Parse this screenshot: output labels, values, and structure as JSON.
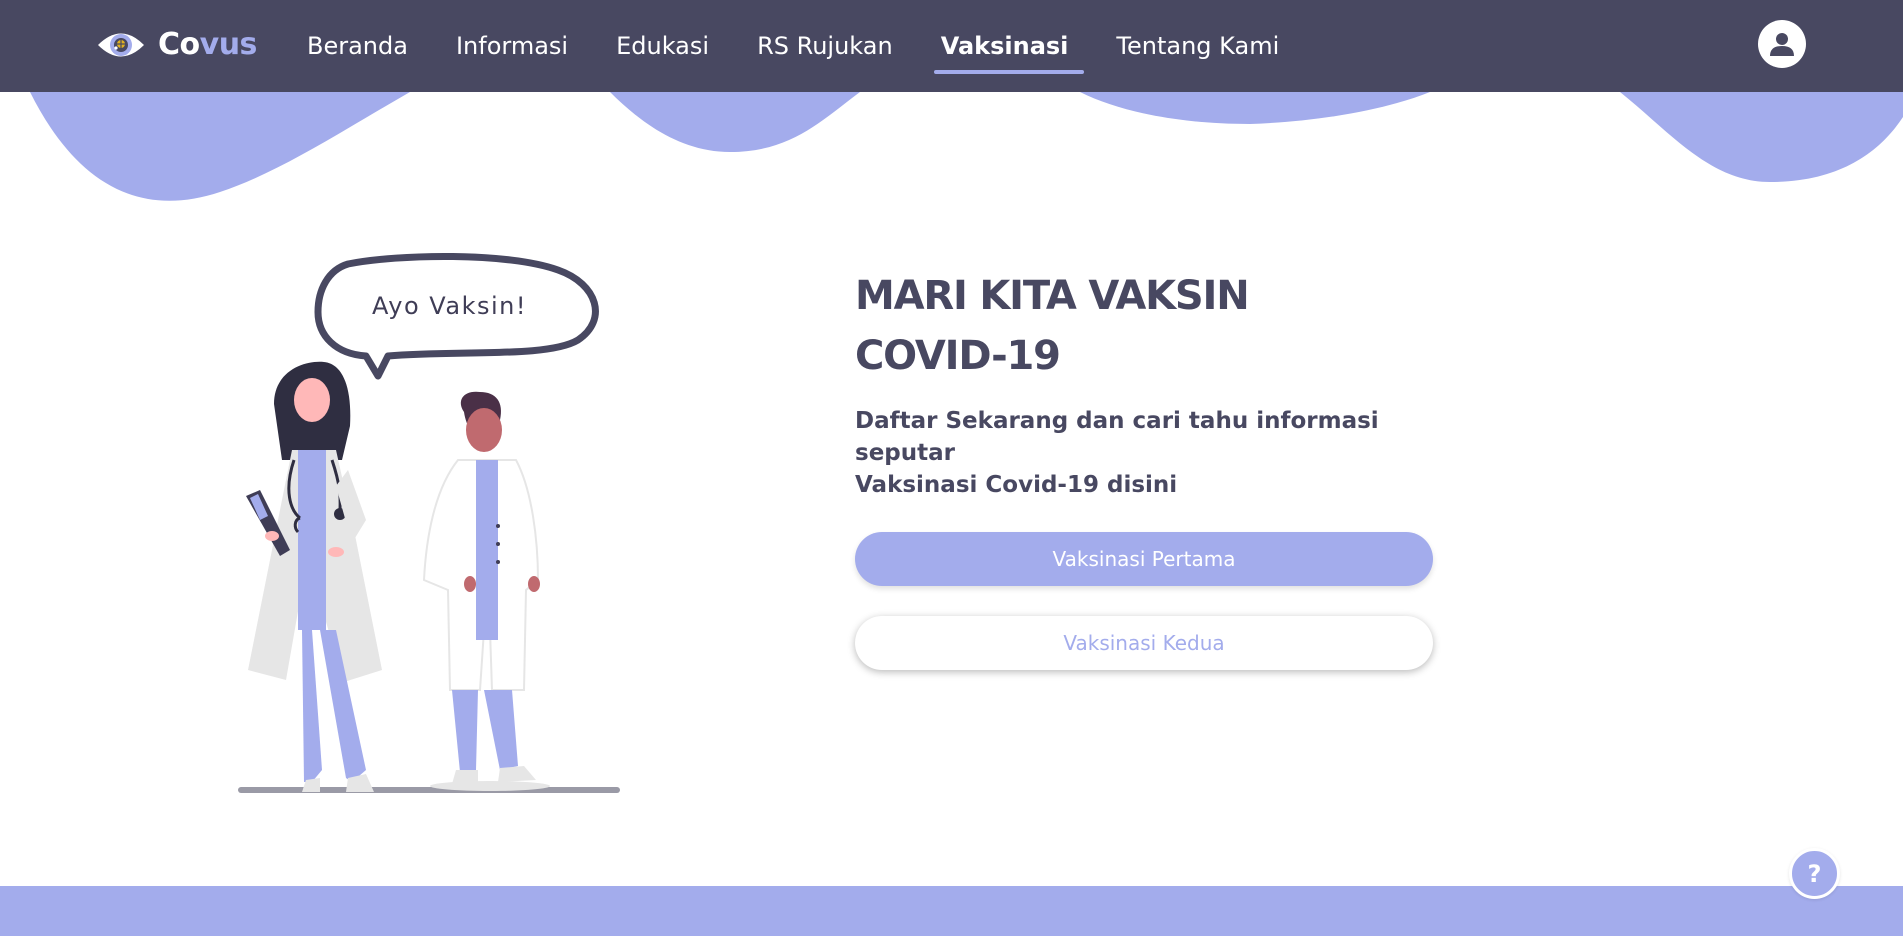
{
  "brand": {
    "name_part1": "Co",
    "name_part2": "vus",
    "logo_icon": "eye-virus-logo"
  },
  "nav": {
    "items": [
      {
        "label": "Beranda",
        "active": false
      },
      {
        "label": "Informasi",
        "active": false
      },
      {
        "label": "Edukasi",
        "active": false
      },
      {
        "label": "RS Rujukan",
        "active": false
      },
      {
        "label": "Vaksinasi",
        "active": true
      },
      {
        "label": "Tentang Kami",
        "active": false
      }
    ],
    "profile_icon": "user-icon"
  },
  "hero": {
    "bubble_text": "Ayo Vaksin!",
    "title_line1": "MARI KITA VAKSIN",
    "title_line2": "COVID-19",
    "subtitle_line1": "Daftar Sekarang dan cari tahu informasi seputar",
    "subtitle_line2": "Vaksinasi Covid-19 disini"
  },
  "buttons": {
    "primary_label": "Vaksinasi Pertama",
    "secondary_label": "Vaksinasi Kedua"
  },
  "help": {
    "label": "?",
    "icon": "help-icon"
  },
  "colors": {
    "navbar": "#484861",
    "accent": "#a3acec",
    "text_dark": "#484861",
    "white": "#ffffff"
  }
}
